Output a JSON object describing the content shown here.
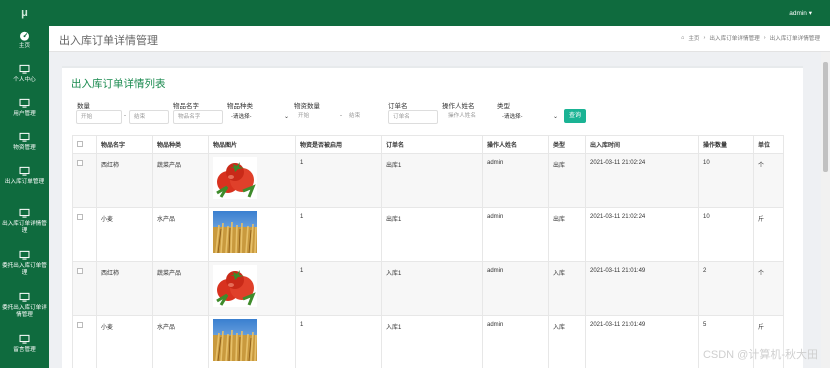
{
  "sidebar": {
    "logo": "μ",
    "items": [
      {
        "label": "主页",
        "icon": "dashboard-icon"
      },
      {
        "label": "个人中心",
        "icon": "monitor-icon"
      },
      {
        "label": "用户管理",
        "icon": "monitor-icon"
      },
      {
        "label": "物资管理",
        "icon": "monitor-icon"
      },
      {
        "label": "出入库订单管理",
        "icon": "monitor-icon"
      },
      {
        "label": "出入库订单详情管理",
        "icon": "monitor-icon"
      },
      {
        "label": "委托出入库订单管理",
        "icon": "monitor-icon"
      },
      {
        "label": "委托出入库订单详情管理",
        "icon": "monitor-icon"
      },
      {
        "label": "留言管理",
        "icon": "monitor-icon"
      }
    ]
  },
  "topbar": {
    "user": "admin ▾"
  },
  "header": {
    "title": "出入库订单详情管理",
    "crumbs": [
      "主页",
      "出入库订单详情管理",
      "出入库订单详情管理"
    ]
  },
  "panel": {
    "title": "出入库订单详情列表"
  },
  "search": {
    "qty_label": "数量",
    "qty_start": "开始",
    "qty_end": "结束",
    "name_label": "物品名字",
    "name_placeholder": "物品名字",
    "kind_label": "物品种类",
    "kind_value": "-请选择-",
    "stock_label": "物资数量",
    "stock_start": "开始",
    "stock_end": "结束",
    "order_label": "订单名",
    "order_placeholder": "订单名",
    "operator_label": "操作人姓名",
    "operator_placeholder": "操作人姓名",
    "type_label": "类型",
    "type_value": "-请选择-",
    "button": "查询"
  },
  "table": {
    "headers": [
      "物品名字",
      "物品种类",
      "物品图片",
      "物资是否被启用",
      "订单名",
      "操作人姓名",
      "类型",
      "出入库时间",
      "操作数量",
      "单位"
    ],
    "rows": [
      {
        "name": "西红柿",
        "kind": "蔬菜产品",
        "image": "tomato",
        "enabled": "1",
        "order": "出库1",
        "operator": "admin",
        "type": "出库",
        "time": "2021-03-11 21:02:24",
        "qty": "10",
        "unit": "个"
      },
      {
        "name": "小麦",
        "kind": "水产品",
        "image": "wheat",
        "enabled": "1",
        "order": "出库1",
        "operator": "admin",
        "type": "出库",
        "time": "2021-03-11 21:02:24",
        "qty": "10",
        "unit": "斤"
      },
      {
        "name": "西红柿",
        "kind": "蔬菜产品",
        "image": "tomato",
        "enabled": "1",
        "order": "入库1",
        "operator": "admin",
        "type": "入库",
        "time": "2021-03-11 21:01:49",
        "qty": "2",
        "unit": "个"
      },
      {
        "name": "小麦",
        "kind": "水产品",
        "image": "wheat",
        "enabled": "1",
        "order": "入库1",
        "operator": "admin",
        "type": "入库",
        "time": "2021-03-11 21:01:49",
        "qty": "5",
        "unit": "斤"
      }
    ]
  },
  "watermark": "CSDN @计算机-秋大田",
  "colors": {
    "brand": "#0f6b3e",
    "accent": "#1a8a4f",
    "button": "#1ab394"
  }
}
